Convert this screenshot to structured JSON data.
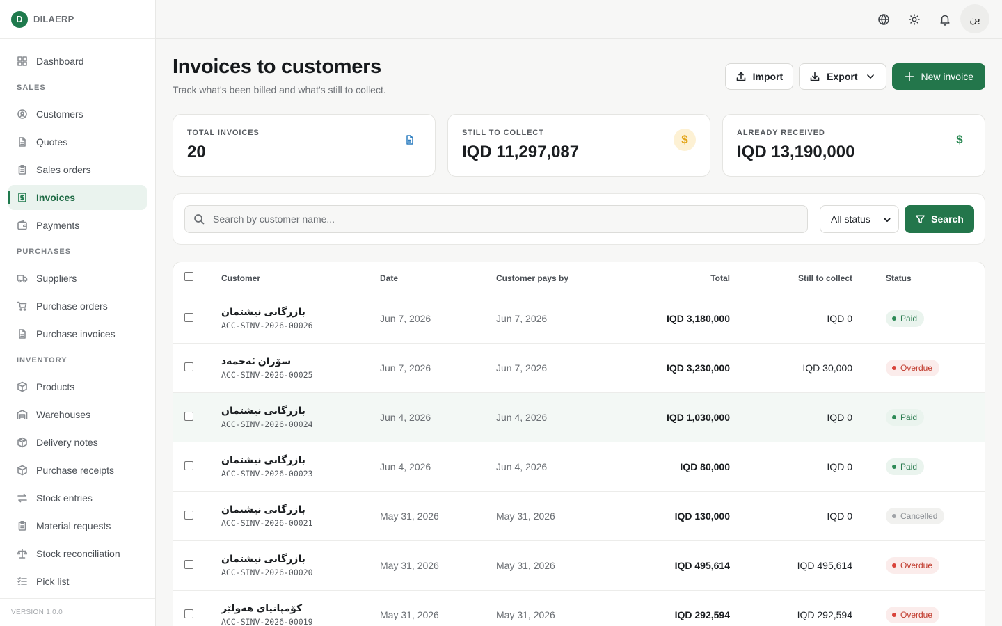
{
  "brand": {
    "logo_letter": "D",
    "name": "DILAERP"
  },
  "sidebar": {
    "dashboard": "Dashboard",
    "sections": {
      "sales": "SALES",
      "purchases": "PURCHASES",
      "inventory": "INVENTORY"
    },
    "sales_items": [
      "Customers",
      "Quotes",
      "Sales orders",
      "Invoices",
      "Payments"
    ],
    "purchase_items": [
      "Suppliers",
      "Purchase orders",
      "Purchase invoices"
    ],
    "inventory_items": [
      "Products",
      "Warehouses",
      "Delivery notes",
      "Purchase receipts",
      "Stock entries",
      "Material requests",
      "Stock reconciliation",
      "Pick list"
    ],
    "active_item": "Invoices",
    "version": "VERSION 1.0.0"
  },
  "topbar": {
    "avatar_text": "بن",
    "icons": [
      "globe-icon",
      "sun-icon",
      "bell-icon"
    ]
  },
  "header": {
    "title": "Invoices to customers",
    "subtitle": "Track what's been billed and what's still to collect.",
    "import_label": "Import",
    "export_label": "Export",
    "new_label": "New invoice"
  },
  "stats": [
    {
      "label": "TOTAL INVOICES",
      "value": "20",
      "icon": "document-icon",
      "icon_color": "#2f7fc1"
    },
    {
      "label": "STILL TO COLLECT",
      "value": "IQD 11,297,087",
      "icon": "dollar-icon",
      "icon_color": "#e3a416"
    },
    {
      "label": "ALREADY RECEIVED",
      "value": "IQD 13,190,000",
      "icon": "dollar-icon",
      "icon_color": "#2d8a56"
    }
  ],
  "filters": {
    "search_placeholder": "Search by customer name...",
    "status_value": "All status",
    "search_label": "Search"
  },
  "table": {
    "columns": {
      "customer": "Customer",
      "date": "Date",
      "pays_by": "Customer pays by",
      "total": "Total",
      "still": "Still to collect",
      "status": "Status"
    },
    "rows": [
      {
        "customer": "بازرگانی نیشتمان",
        "id": "ACC-SINV-2026-00026",
        "date": "Jun 7, 2026",
        "pays_by": "Jun 7, 2026",
        "total": "IQD 3,180,000",
        "still": "IQD 0",
        "status": "Paid"
      },
      {
        "customer": "سۆران ئەحمەد",
        "id": "ACC-SINV-2026-00025",
        "date": "Jun 7, 2026",
        "pays_by": "Jun 7, 2026",
        "total": "IQD 3,230,000",
        "still": "IQD 30,000",
        "status": "Overdue"
      },
      {
        "customer": "بازرگانی نیشتمان",
        "id": "ACC-SINV-2026-00024",
        "date": "Jun 4, 2026",
        "pays_by": "Jun 4, 2026",
        "total": "IQD 1,030,000",
        "still": "IQD 0",
        "status": "Paid"
      },
      {
        "customer": "بازرگانی نیشتمان",
        "id": "ACC-SINV-2026-00023",
        "date": "Jun 4, 2026",
        "pays_by": "Jun 4, 2026",
        "total": "IQD 80,000",
        "still": "IQD 0",
        "status": "Paid"
      },
      {
        "customer": "بازرگانی نیشتمان",
        "id": "ACC-SINV-2026-00021",
        "date": "May 31, 2026",
        "pays_by": "May 31, 2026",
        "total": "IQD 130,000",
        "still": "IQD 0",
        "status": "Cancelled"
      },
      {
        "customer": "بازرگانی نیشتمان",
        "id": "ACC-SINV-2026-00020",
        "date": "May 31, 2026",
        "pays_by": "May 31, 2026",
        "total": "IQD 495,614",
        "still": "IQD 495,614",
        "status": "Overdue"
      },
      {
        "customer": "کۆمپانیای هەولێر",
        "id": "ACC-SINV-2026-00019",
        "date": "May 31, 2026",
        "pays_by": "May 31, 2026",
        "total": "IQD 292,594",
        "still": "IQD 292,594",
        "status": "Overdue"
      }
    ]
  },
  "colors": {
    "accent": "#23764b",
    "paid": "#2d7d52",
    "overdue": "#c0392b",
    "cancelled": "#8a8e93"
  }
}
